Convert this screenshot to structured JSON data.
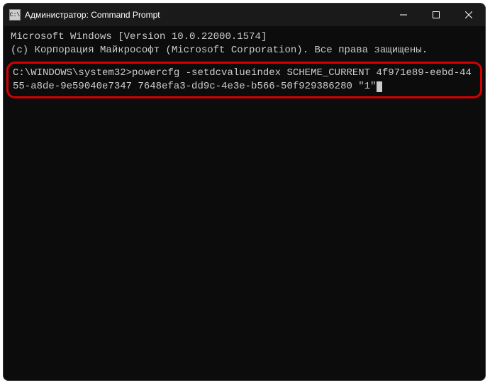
{
  "window": {
    "title": "Администратор: Command Prompt",
    "icon_label": "cmd-icon"
  },
  "terminal": {
    "line1": "Microsoft Windows [Version 10.0.22000.1574]",
    "line2": "(c) Корпорация Майкрософт (Microsoft Corporation). Все права защищены.",
    "prompt": "C:\\WINDOWS\\system32>",
    "command": "powercfg -setdcvalueindex SCHEME_CURRENT 4f971e89-eebd-4455-a8de-9e59040e7347 7648efa3-dd9c-4e3e-b566-50f929386280 \"1\""
  },
  "colors": {
    "highlight": "#d60000"
  }
}
